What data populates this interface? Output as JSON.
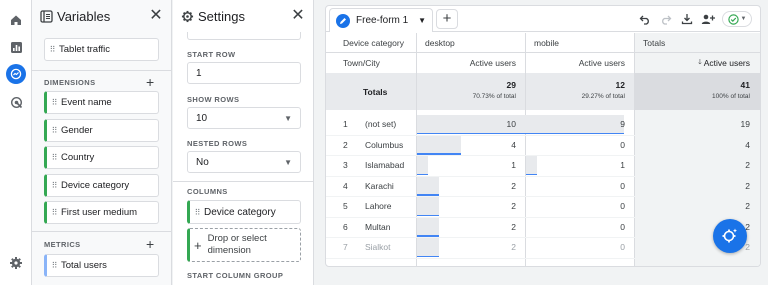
{
  "rail": {
    "items": [
      "home-icon",
      "reports-icon",
      "explore-icon",
      "advertising-icon"
    ],
    "bottom": "settings-icon"
  },
  "variables": {
    "title": "Variables",
    "segment": "Tablet traffic",
    "dimensions_label": "DIMENSIONS",
    "dimensions": [
      "Event name",
      "Gender",
      "Country",
      "Device category",
      "First user medium"
    ],
    "metrics_label": "METRICS",
    "metrics": [
      "Total users"
    ]
  },
  "settings": {
    "title": "Settings",
    "start_row_label": "START ROW",
    "start_row": "1",
    "show_rows_label": "SHOW ROWS",
    "show_rows": "10",
    "nested_label": "NESTED ROWS",
    "nested": "No",
    "columns_label": "COLUMNS",
    "column_dim": "Device category",
    "drop_text": "Drop or select dimension",
    "start_col_label": "START COLUMN GROUP"
  },
  "tab": {
    "name": "Free-form 1"
  },
  "colors": {
    "accent": "#1a73e8",
    "green": "#34a853",
    "bar": "#4285f4"
  },
  "table": {
    "h_device": "Device category",
    "h_desktop": "desktop",
    "h_mobile": "mobile",
    "h_totals": "Totals",
    "h_town": "Town/City",
    "h_active": "Active users",
    "h_active_sorted": "Active users",
    "totals": {
      "label": "Totals",
      "desktop": "29",
      "desktop_pct": "70.73% of total",
      "mobile": "12",
      "mobile_pct": "29.27% of total",
      "all": "41",
      "all_pct": "100% of total"
    },
    "rows": [
      {
        "n": "1",
        "city": "(not set)",
        "desktop": 10,
        "mobile": 9,
        "total": "19"
      },
      {
        "n": "2",
        "city": "Columbus",
        "desktop": 4,
        "mobile": 0,
        "total": "4"
      },
      {
        "n": "3",
        "city": "Islamabad",
        "desktop": 1,
        "mobile": 1,
        "total": "2"
      },
      {
        "n": "4",
        "city": "Karachi",
        "desktop": 2,
        "mobile": 0,
        "total": "2"
      },
      {
        "n": "5",
        "city": "Lahore",
        "desktop": 2,
        "mobile": 0,
        "total": "2"
      },
      {
        "n": "6",
        "city": "Multan",
        "desktop": 2,
        "mobile": 0,
        "total": "2"
      },
      {
        "n": "7",
        "city": "Sialkot",
        "desktop": 2,
        "mobile": 0,
        "total": "2"
      }
    ]
  }
}
